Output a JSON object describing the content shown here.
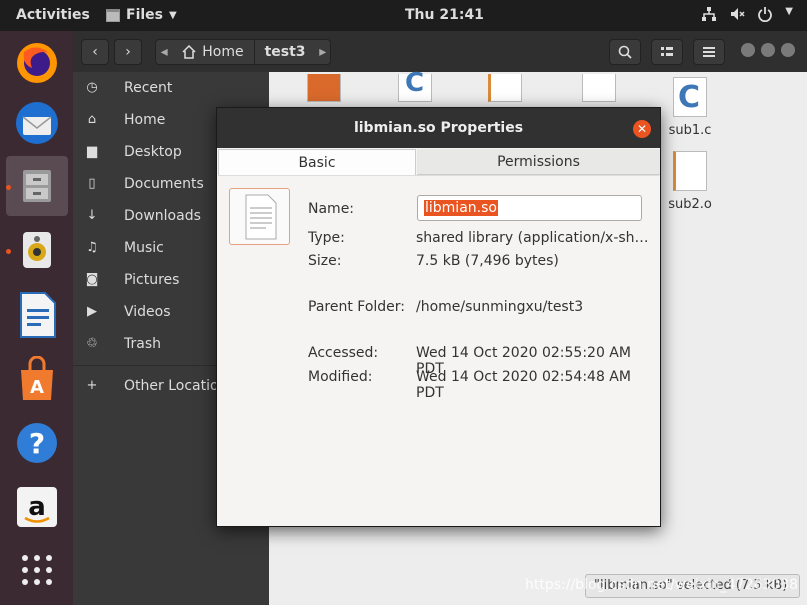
{
  "topbar": {
    "activities": "Activities",
    "app_name": "Files",
    "clock": "Thu 21:41"
  },
  "nav": {
    "home_crumb": "Home",
    "current_crumb": "test3"
  },
  "sidebar": {
    "items": [
      {
        "label": "Recent",
        "icon": "clock-icon"
      },
      {
        "label": "Home",
        "icon": "home-icon"
      },
      {
        "label": "Desktop",
        "icon": "folder-icon"
      },
      {
        "label": "Documents",
        "icon": "document-icon"
      },
      {
        "label": "Downloads",
        "icon": "download-icon"
      },
      {
        "label": "Music",
        "icon": "music-icon"
      },
      {
        "label": "Pictures",
        "icon": "camera-icon"
      },
      {
        "label": "Videos",
        "icon": "video-icon"
      },
      {
        "label": "Trash",
        "icon": "trash-icon"
      },
      {
        "label": "Other Locations",
        "icon": "plus-icon"
      }
    ]
  },
  "files": {
    "sub1c": "sub1.c",
    "sub2o": "sub2.o"
  },
  "dialog": {
    "title": "libmian.so Properties",
    "tab_basic": "Basic",
    "tab_permissions": "Permissions",
    "name_label": "Name:",
    "name_value": "libmian.so",
    "type_label": "Type:",
    "type_value": "shared library (application/x-sh…",
    "size_label": "Size:",
    "size_value": "7.5 kB (7,496 bytes)",
    "parent_label": "Parent Folder:",
    "parent_value": "/home/sunmingxu/test3",
    "accessed_label": "Accessed:",
    "accessed_value": "Wed 14 Oct 2020 02:55:20 AM PDT",
    "modified_label": "Modified:",
    "modified_value": "Wed 14 Oct 2020 02:54:48 AM PDT"
  },
  "status": "\"libmian.so\" selected (7.5 kB)",
  "watermark": "https://blog.csdn.net/weixin_47263038",
  "colors": {
    "accent": "#e95420",
    "dock": "#3c2a33",
    "header": "#2f2f2f"
  }
}
